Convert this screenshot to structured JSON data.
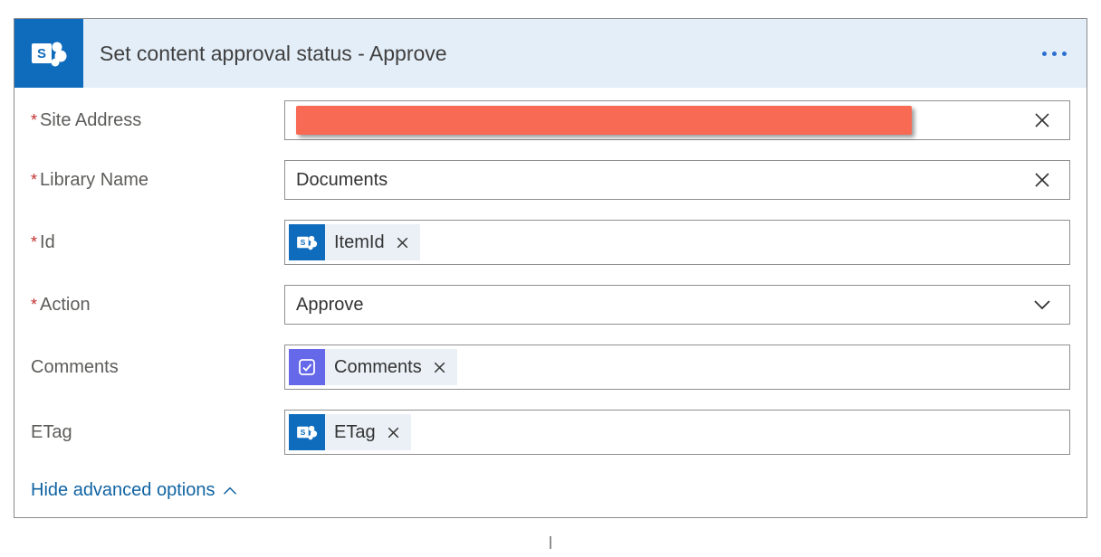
{
  "header": {
    "title": "Set content approval status - Approve"
  },
  "fields": {
    "siteAddress": {
      "label": "Site Address",
      "required": true,
      "redacted": true
    },
    "libraryName": {
      "label": "Library Name",
      "required": true,
      "value": "Documents"
    },
    "id": {
      "label": "Id",
      "required": true,
      "tokenLabel": "ItemId",
      "tokenSource": "sharepoint"
    },
    "action": {
      "label": "Action",
      "required": true,
      "value": "Approve"
    },
    "comments": {
      "label": "Comments",
      "required": false,
      "tokenLabel": "Comments",
      "tokenSource": "approvals"
    },
    "etag": {
      "label": "ETag",
      "required": false,
      "tokenLabel": "ETag",
      "tokenSource": "sharepoint"
    }
  },
  "advancedToggle": "Hide advanced options"
}
